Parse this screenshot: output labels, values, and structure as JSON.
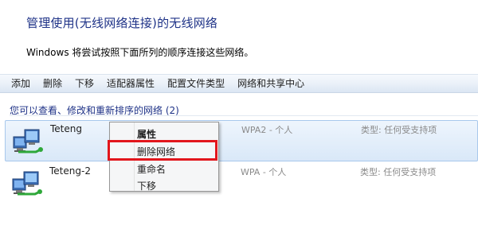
{
  "window": {
    "title": "管理使用(无线网络连接)的无线网络",
    "description": "Windows 将尝试按照下面所列的顺序连接这些网络。"
  },
  "toolbar": {
    "items": [
      "添加",
      "删除",
      "下移",
      "适配器属性",
      "配置文件类型",
      "网络和共享中心"
    ]
  },
  "list": {
    "group_header": "您可以查看、修改和重新排序的网络 (2)",
    "networks": [
      {
        "name": "Teteng",
        "security": "WPA2 - 个人",
        "type": "类型: 任何受支持项",
        "selected": true
      },
      {
        "name": "Teteng-2",
        "security": "WPA - 个人",
        "type": "类型: 任何受支持项",
        "selected": false
      }
    ]
  },
  "context_menu": {
    "items": [
      "属性",
      "删除网络",
      "重命名",
      "下移"
    ],
    "highlighted": "删除网络"
  },
  "colors": {
    "title": "#1e3287",
    "highlight_border": "#e2161c",
    "selection": "#d9e8f8"
  },
  "icons": {
    "network": "wireless-network-icon"
  }
}
